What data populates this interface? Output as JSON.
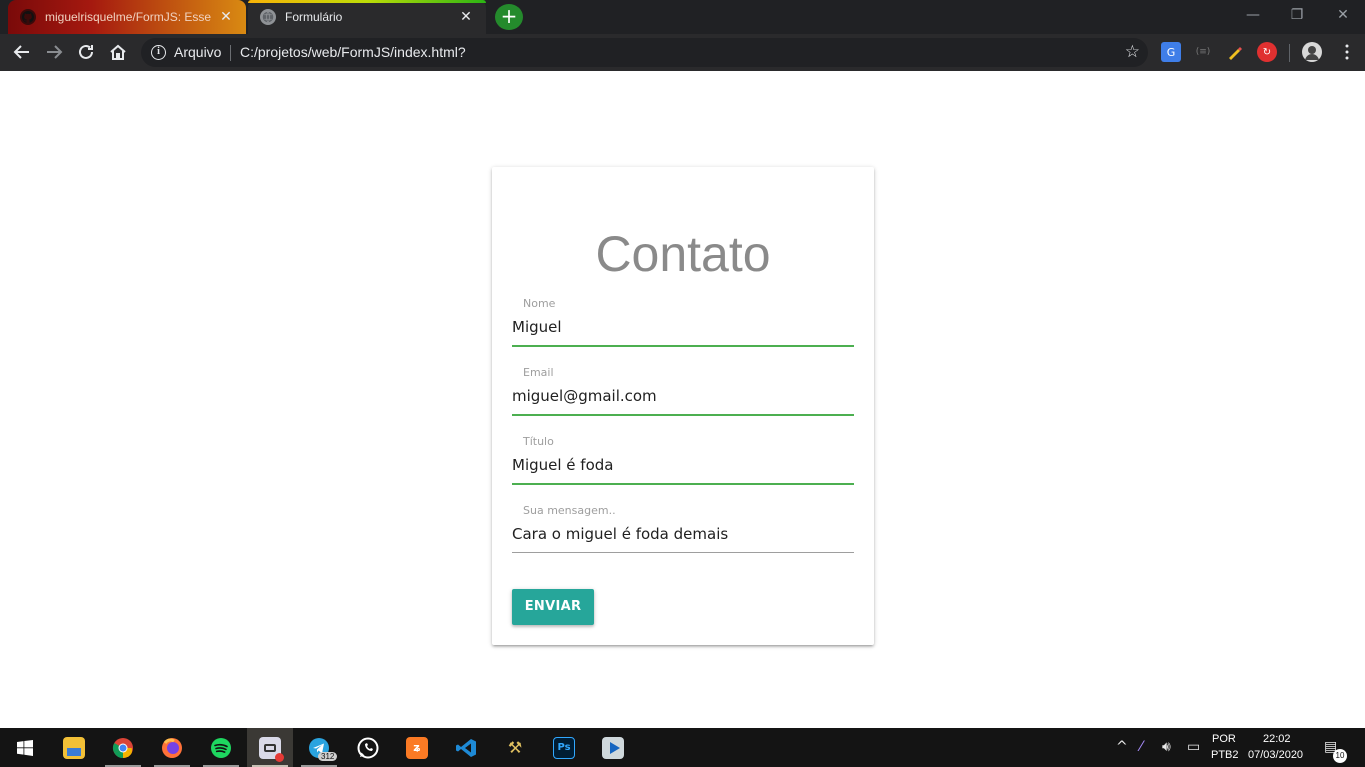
{
  "browser": {
    "tabs": [
      {
        "title": "miguelrisquelme/FormJS: Esse é",
        "icon": "github-icon",
        "close": "✕"
      },
      {
        "title": "Formulário",
        "icon": "globe-icon",
        "close": "✕"
      }
    ],
    "new_tab": "+",
    "window_controls": {
      "minimize": "—",
      "restore": "❐",
      "close": "✕"
    },
    "address": {
      "scheme_label": "Arquivo",
      "url": "C:/projetos/web/FormJS/index.html?"
    }
  },
  "form": {
    "title": "Contato",
    "fields": [
      {
        "label": "Nome",
        "value": "Miguel"
      },
      {
        "label": "Email",
        "value": "miguel@gmail.com"
      },
      {
        "label": "Título",
        "value": "Miguel é foda"
      },
      {
        "label": "Sua mensagem..",
        "value": "Cara o miguel é foda demais"
      }
    ],
    "submit_label": "ENVIAR"
  },
  "taskbar": {
    "apps": [
      "windows-start-icon",
      "file-explorer-icon",
      "chrome-icon",
      "firefox-icon",
      "spotify-icon",
      "capture-app-icon",
      "telegram-icon",
      "whatsapp-icon",
      "xampp-icon",
      "vscode-icon",
      "tools-icon",
      "photoshop-icon",
      "media-player-icon"
    ],
    "telegram_badge": "312",
    "language_top": "POR",
    "language_bottom": "PTB2",
    "time": "22:02",
    "date": "07/03/2020",
    "notification_count": "10"
  },
  "colors": {
    "accent_green": "#4caf50",
    "button_teal": "#26a69a"
  }
}
